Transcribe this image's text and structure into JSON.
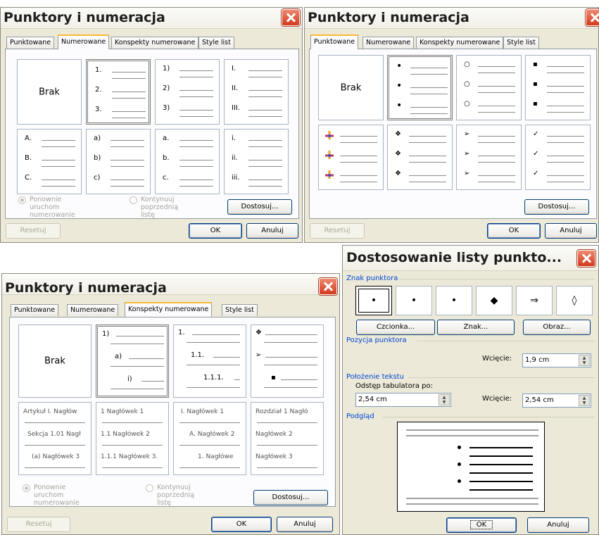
{
  "dialog_numbered": {
    "title": "Punktory i numeracja",
    "tabs": [
      "Punktowane",
      "Numerowane",
      "Konspekty numerowane",
      "Style list"
    ],
    "active_tab": 1,
    "none_label": "Brak",
    "lists": [
      [
        "1.",
        "2.",
        "3."
      ],
      [
        "1)",
        "2)",
        "3)"
      ],
      [
        "I.",
        "II.",
        "III."
      ],
      [
        "A.",
        "B.",
        "C."
      ],
      [
        "a)",
        "b)",
        "c)"
      ],
      [
        "a.",
        "b.",
        "c."
      ],
      [
        "i.",
        "ii.",
        "iii."
      ]
    ],
    "radio_restart": "Ponownie uruchom\nnumerowanie",
    "radio_continue": "Kontynuuj poprzednią\nlistę",
    "customize_button": "Dostosuj...",
    "reset_button": "Resetuj",
    "ok_button": "OK",
    "cancel_button": "Anuluj"
  },
  "dialog_bulleted": {
    "title": "Punktory i numeracja",
    "tabs": [
      "Punktowane",
      "Numerowane",
      "Konspekty numerowane",
      "Style list"
    ],
    "active_tab": 0,
    "none_label": "Brak",
    "bullets": [
      "•",
      "○",
      "▪",
      "picture-bullet",
      "❖",
      "➢",
      "✓"
    ],
    "customize_button": "Dostosuj...",
    "reset_button": "Resetuj",
    "ok_button": "OK",
    "cancel_button": "Anuluj"
  },
  "dialog_outline": {
    "title": "Punktory i numeracja",
    "tabs": [
      "Punktowane",
      "Numerowane",
      "Konspekty numerowane",
      "Style list"
    ],
    "active_tab": 2,
    "none_label": "Brak",
    "outline_top": [
      [
        "1)",
        "a)",
        "i)"
      ],
      [
        "1.",
        "1.1.",
        "1.1.1."
      ],
      [
        "❖",
        "➢",
        "▪"
      ]
    ],
    "outline_bottom": [
      [
        "Artykuł I. Nagłów",
        "Sekcja 1.01 Nagł",
        "(a) Nagłówek 3"
      ],
      [
        "1 Nagłówek 1",
        "1.1 Nagłówek 2",
        "1.1.1 Nagłówek 3."
      ],
      [
        "I. Nagłówek 1",
        "A. Nagłówek 2",
        "1. Nagłówe"
      ],
      [
        "Rozdział 1 Nagłó",
        "Nagłówek 2",
        "Nagłówek 3"
      ]
    ],
    "radio_restart": "Ponownie uruchom\nnumerowanie",
    "radio_continue": "Kontynuuj poprzednią\nlistę",
    "customize_button": "Dostosuj...",
    "reset_button": "Resetuj",
    "ok_button": "OK",
    "cancel_button": "Anuluj"
  },
  "dialog_customize": {
    "title": "Dostosowanie listy punkto...",
    "bullet_char_section": "Znak punktora",
    "bullet_chars": [
      "•",
      "•",
      "•",
      "◆",
      "⇒",
      "◊"
    ],
    "font_button": "Czcionka...",
    "char_button": "Znak...",
    "image_button": "Obraz...",
    "bullet_position_section": "Pozycja punktora",
    "indent_label": "Wcięcie:",
    "bullet_indent_value": "1,9 cm",
    "text_position_section": "Położenie tekstu",
    "tab_space_label": "Odstęp tabulatora po:",
    "tab_space_value": "2,54 cm",
    "text_indent_label": "Wcięcie:",
    "text_indent_value": "2,54 cm",
    "preview_section": "Podgląd",
    "ok_button": "OK",
    "cancel_button": "Anuluj"
  }
}
